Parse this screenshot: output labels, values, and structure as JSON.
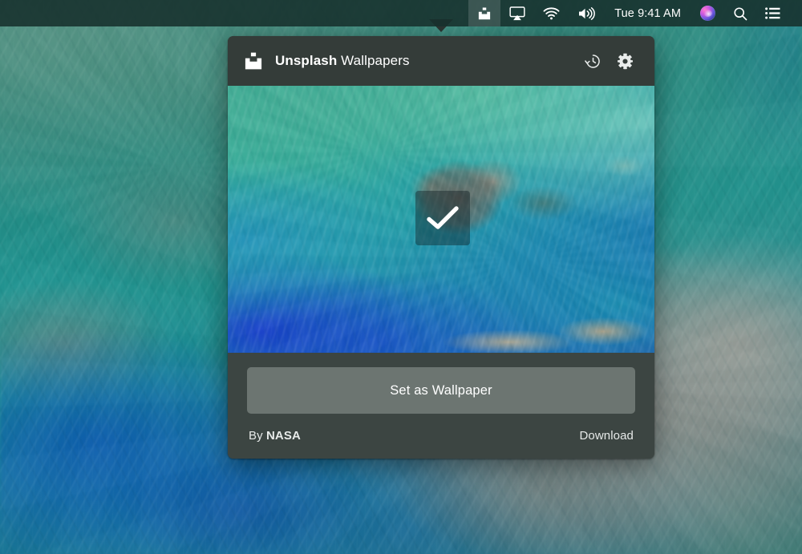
{
  "menubar": {
    "background_color": "#173029",
    "items": [
      {
        "name": "unsplash-menu-icon",
        "icon": "unsplash-icon",
        "label": ""
      },
      {
        "name": "airplay-menu-icon",
        "icon": "airplay-icon",
        "label": ""
      },
      {
        "name": "wifi-menu-icon",
        "icon": "wifi-icon",
        "label": ""
      },
      {
        "name": "volume-menu-icon",
        "icon": "volume-icon",
        "label": ""
      }
    ],
    "clock": "Tue 9:41 AM",
    "siri_label": "Siri",
    "spotlight_label": "Spotlight Search",
    "notification_center_label": "Notification Center"
  },
  "popover": {
    "header": {
      "logo_icon": "unsplash-icon",
      "title_bold": "Unsplash",
      "title_regular": "Wallpapers",
      "history_icon": "history-clock-icon",
      "history_label": "History",
      "settings_icon": "gear-icon",
      "settings_label": "Settings"
    },
    "preview": {
      "alt": "Satellite photograph of turquoise ocean shallows and an island",
      "selected_icon": "checkmark-icon",
      "selected": true
    },
    "actions": {
      "set_wallpaper_label": "Set as Wallpaper",
      "credit_prefix": "By",
      "credit_author": "NASA",
      "download_label": "Download"
    },
    "colors": {
      "header_bg": "#343c39",
      "body_bg": "#3c4542",
      "button_bg": "#6c7571",
      "text": "#ffffff"
    }
  }
}
